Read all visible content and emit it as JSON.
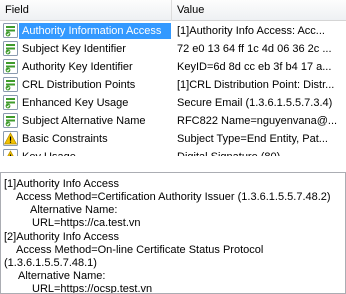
{
  "list": {
    "columns": {
      "field": "Field",
      "value": "Value"
    },
    "rows": [
      {
        "field": "Authority Information Access",
        "value": "[1]Authority Info Access: Acc...",
        "icon": "cert-extension-icon",
        "selected": true
      },
      {
        "field": "Subject Key Identifier",
        "value": "72 e0 13 64 ff 1c 4d 06 36 2c ...",
        "icon": "cert-extension-icon"
      },
      {
        "field": "Authority Key Identifier",
        "value": "KeyID=6d 8d cc eb 3f b4 17 a...",
        "icon": "cert-extension-icon"
      },
      {
        "field": "CRL Distribution Points",
        "value": "[1]CRL Distribution Point: Distr...",
        "icon": "cert-extension-icon"
      },
      {
        "field": "Enhanced Key Usage",
        "value": "Secure Email (1.3.6.1.5.5.7.3.4)",
        "icon": "cert-extension-icon"
      },
      {
        "field": "Subject Alternative Name",
        "value": "RFC822 Name=nguyenvana@...",
        "icon": "cert-extension-icon"
      },
      {
        "field": "Basic Constraints",
        "value": "Subject Type=End Entity, Pat...",
        "icon": "warning-critical-icon"
      },
      {
        "field": "Key Usage",
        "value": "Digital Signature (80)",
        "icon": "warning-critical-icon"
      }
    ]
  },
  "details": {
    "lines": [
      "[1]Authority Info Access",
      "Access Method=Certification Authority Issuer (1.3.6.1.5.5.7.48.2)",
      "Alternative Name:",
      "URL=https://ca.test.vn",
      "[2]Authority Info Access",
      "Access Method=On-line Certificate Status Protocol",
      "(1.3.6.1.5.5.7.48.1)",
      "Alternative Name:",
      "URL=https://ocsp.test.vn"
    ]
  },
  "colors": {
    "selection": "#3399ff",
    "icon_green": "#3f9c2c",
    "warning_yellow": "#f2c200"
  }
}
